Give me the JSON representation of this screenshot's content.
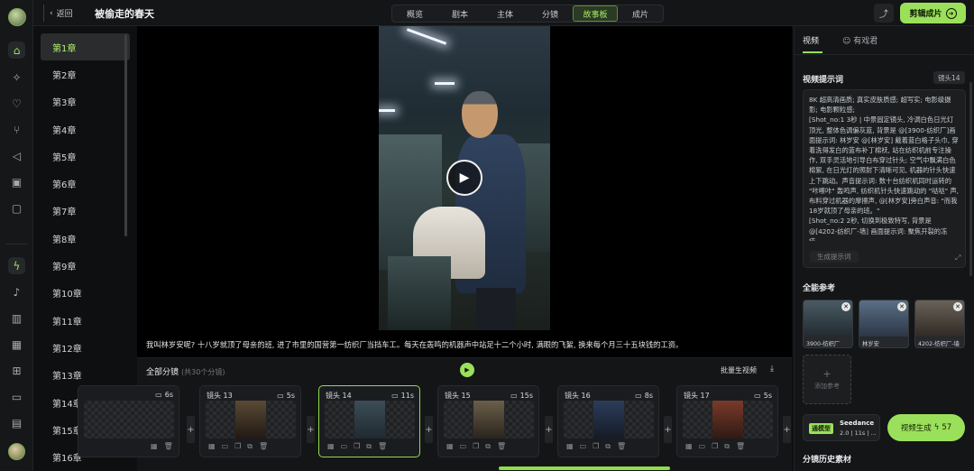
{
  "topbar": {
    "back_label": "返回",
    "project_title": "被偷走的春天",
    "steps": [
      "概览",
      "剧本",
      "主体",
      "分镜",
      "故事板",
      "成片"
    ],
    "active_step": "故事板",
    "edit_label": "剪辑成片",
    "share_icon": "share-icon"
  },
  "rail_icons": [
    "home-icon",
    "sparkle-icon",
    "heart-icon",
    "nodes-icon",
    "megaphone-icon",
    "briefcase-icon",
    "wallet-icon",
    "lightning-icon",
    "bell-icon",
    "book-icon",
    "qrcode-icon",
    "gift-icon",
    "chat-icon",
    "card-icon"
  ],
  "chapters": [
    "第1章",
    "第2章",
    "第3章",
    "第4章",
    "第5章",
    "第6章",
    "第7章",
    "第8章",
    "第9章",
    "第10章",
    "第11章",
    "第12章",
    "第13章",
    "第14章",
    "第15章",
    "第16章"
  ],
  "active_chapter": "第1章",
  "caption": "我叫林岁安呢? 十八岁就顶了母亲的班, 进了市里的国营第一纺织厂当挡车工。每天在轰鸣的机器声中站足十二个小时, 满眼的飞絮, 换来每个月三十五块钱的工资。",
  "shots_panel": {
    "title": "全部分镜",
    "count": "(共30个分镜)",
    "batch_label": "批量生视频",
    "shots": [
      {
        "label": "",
        "duration": "6s",
        "active": false
      },
      {
        "label": "镜头 13",
        "duration": "5s",
        "active": false
      },
      {
        "label": "镜头 14",
        "duration": "11s",
        "active": true
      },
      {
        "label": "镜头 15",
        "duration": "15s",
        "active": false
      },
      {
        "label": "镜头 16",
        "duration": "8s",
        "active": false
      },
      {
        "label": "镜头 17",
        "duration": "5s",
        "active": false
      }
    ]
  },
  "right": {
    "tabs": [
      "视频",
      "有戏君"
    ],
    "active_tab": "视频",
    "prompt_label": "视频提示词",
    "shot_tag": "镜头14",
    "prompt_text": "8K 超高清画质; 真实皮肤质感; 超写实; 电影级摄影; 电影颗粒感;\n[Shot_no:1 3秒 | 中景固定镜头, 冷调白色日光灯顶光, 整体色调偏灰蓝, 背景是 @[3900-纺织厂]画面提示词: 林岁安 @[林岁安] 戴着蓝白格子头巾, 穿着洗得发白的蓝布补丁棉袄, 站在纺织机前专注操作, 双手灵活地引导白布穿过针头; 空气中飘满白色棉絮, 在日光灯的照射下清晰可见, 机器的针头快速上下跳动。声音提示词: 数十台纺织机同时运转的 \"咔嚓咔\" 轰鸣声, 纺织机针头快速跳动的 \"哒哒\" 声, 布料穿过机器的摩擦声, @[林岁安]旁白声音: \"而我18岁就顶了母亲的班。\"\n[Shot_no:2 2秒, 切换到极致特写, 背景是 @[4202-纺织厂-墙] 画面提示词: 聚焦开裂的冻疮...",
    "prompt_gen_label": "生成提示词",
    "refs_label": "全能参考",
    "refs": [
      {
        "name": "3900-纺织厂"
      },
      {
        "name": "林岁安"
      },
      {
        "name": "4202-纺织厂-墙"
      }
    ],
    "add_ref_label": "添加参考",
    "model_badge": "通模型",
    "model_name": "Seedance",
    "model_sub": "2.0 | 11s | ...",
    "generate_label": "视频生成",
    "generate_cost": "57",
    "history_label": "分镜历史素材"
  },
  "colors": {
    "accent": "#9be05a",
    "background": "#0e0f10",
    "panel": "#141517"
  }
}
